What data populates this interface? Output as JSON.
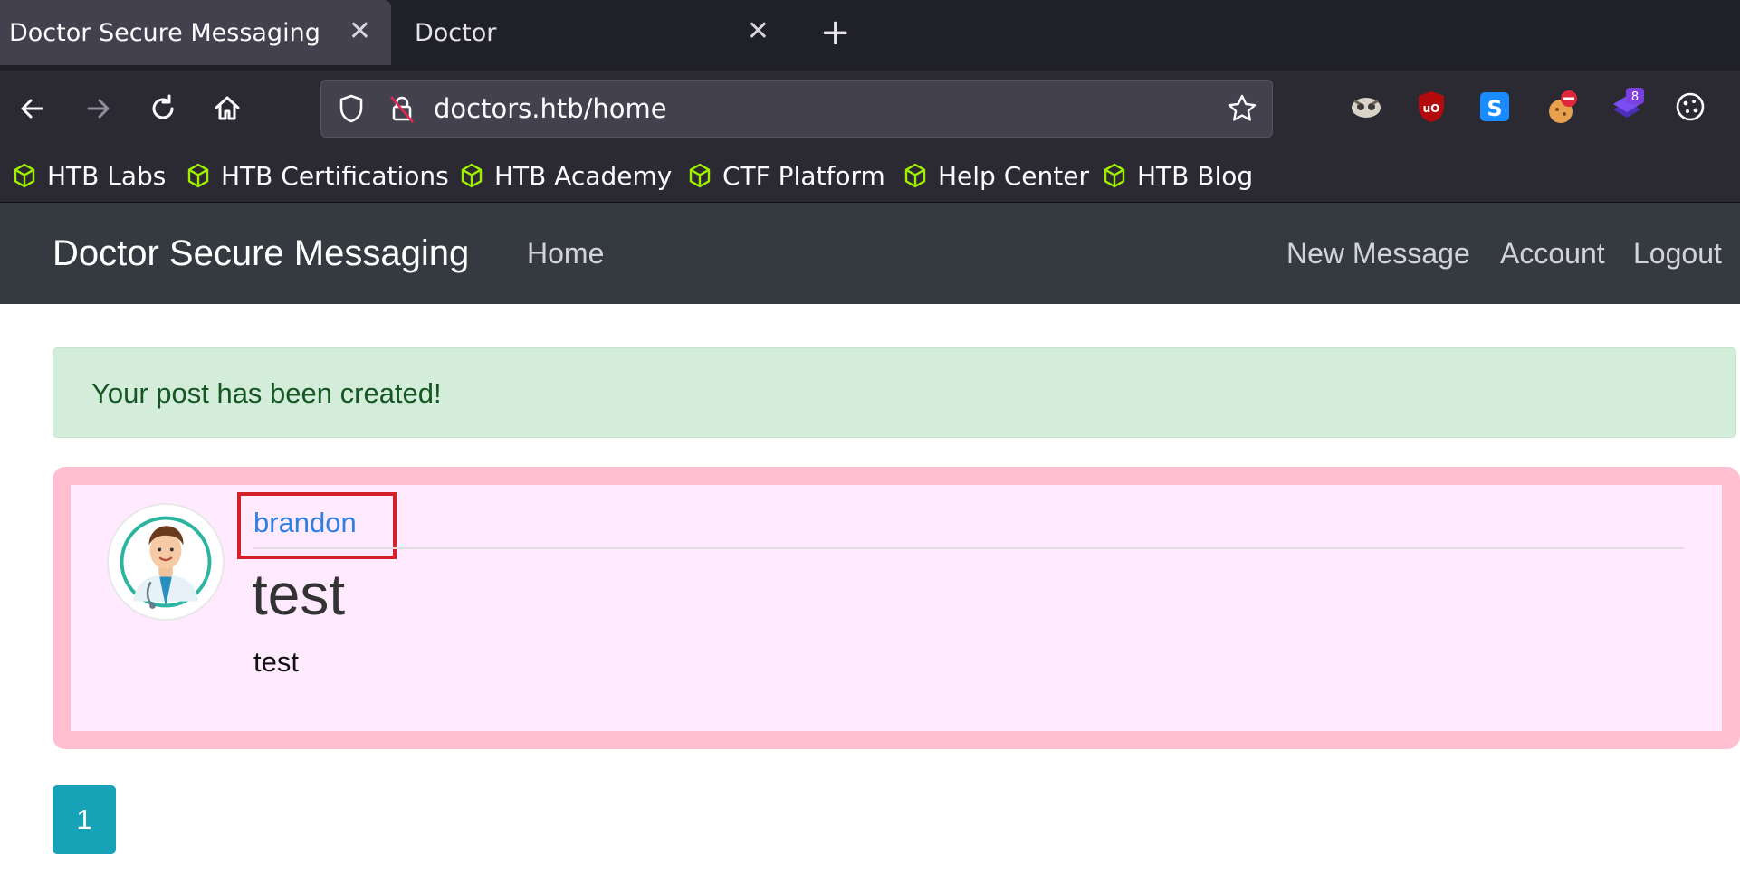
{
  "browser": {
    "tabs": [
      {
        "title": "Doctor Secure Messaging",
        "active": true
      },
      {
        "title": "Doctor",
        "active": false
      }
    ],
    "url": "doctors.htb/home",
    "bookmarks": [
      "HTB Labs",
      "HTB Certifications",
      "HTB Academy",
      "CTF Platform",
      "Help Center",
      "HTB Blog"
    ],
    "extension_badge": "8"
  },
  "site": {
    "brand": "Doctor Secure Messaging",
    "nav_left": [
      "Home"
    ],
    "nav_right": [
      "New Message",
      "Account",
      "Logout"
    ]
  },
  "alert": {
    "text": "Your post has been created!"
  },
  "post": {
    "author": "brandon",
    "title": "test",
    "body": "test"
  },
  "pagination": {
    "current_page": "1"
  },
  "colors": {
    "alert_bg": "#d4edda",
    "post_border": "#ffbfd1",
    "post_bg": "#ffeaff",
    "pagination_bg": "#17a2b8",
    "highlight": "#d3202a"
  }
}
